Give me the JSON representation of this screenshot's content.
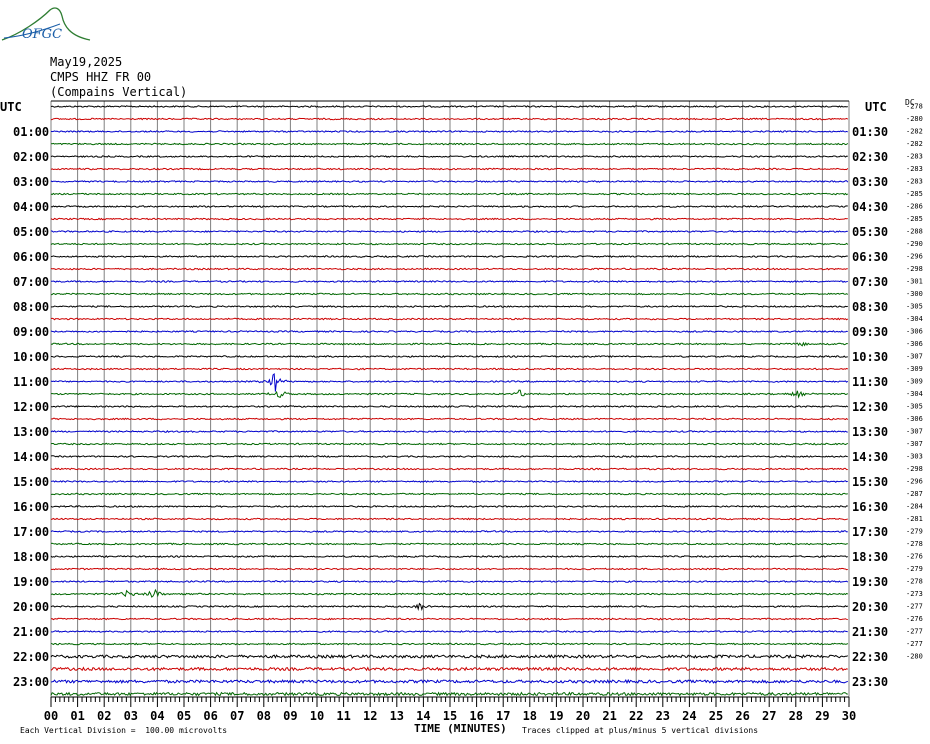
{
  "header": {
    "logo_text": "OFGC",
    "date": "May19,2025",
    "station": "CMPS HHZ FR 00",
    "station_name": "(Compains Vertical)",
    "left_utc": "UTC",
    "right_utc": "UTC",
    "dc_label": "DC"
  },
  "footer": {
    "left_note": "Each Vertical Division =  100.00 microvolts",
    "xlabel": "TIME (MINUTES)",
    "right_note": "Traces clipped at plus/minus 5 vertical divisions"
  },
  "colors": {
    "trace_cycle": [
      "#000000",
      "#cc0000",
      "#0000cc",
      "#006600"
    ],
    "grid": "#808080"
  },
  "chart_data": {
    "type": "line",
    "title": "",
    "xlabel": "TIME (MINUTES)",
    "ylabel": "",
    "xlim": [
      0,
      30
    ],
    "x_ticks": [
      "00",
      "01",
      "02",
      "03",
      "04",
      "05",
      "06",
      "07",
      "08",
      "09",
      "10",
      "11",
      "12",
      "13",
      "14",
      "15",
      "16",
      "17",
      "18",
      "19",
      "20",
      "21",
      "22",
      "23",
      "24",
      "25",
      "26",
      "27",
      "28",
      "29",
      "30"
    ],
    "left_hour_labels": [
      "01:00",
      "02:00",
      "03:00",
      "04:00",
      "05:00",
      "06:00",
      "07:00",
      "08:00",
      "09:00",
      "10:00",
      "11:00",
      "12:00",
      "13:00",
      "14:00",
      "15:00",
      "16:00",
      "17:00",
      "18:00",
      "19:00",
      "20:00",
      "21:00",
      "22:00",
      "23:00"
    ],
    "right_hour_labels": [
      "01:30",
      "02:30",
      "03:30",
      "04:30",
      "05:30",
      "06:30",
      "07:30",
      "08:30",
      "09:30",
      "10:30",
      "11:30",
      "12:30",
      "13:30",
      "14:30",
      "15:30",
      "16:30",
      "17:30",
      "18:30",
      "19:30",
      "20:30",
      "21:30",
      "22:30",
      "23:30"
    ],
    "trace_count": 48,
    "dc_offsets": [
      -278,
      -280,
      -282,
      -282,
      -283,
      -283,
      -283,
      -285,
      -286,
      -285,
      -288,
      -290,
      -296,
      -298,
      -301,
      -300,
      -305,
      -304,
      -306,
      -306,
      -307,
      -309,
      -309,
      -304,
      -305,
      -306,
      -307,
      -307,
      -303,
      -298,
      -296,
      -287,
      -284,
      -281,
      -279,
      -278,
      -276,
      -279,
      -278,
      -273,
      -277,
      -276,
      -277,
      -277,
      -280
    ],
    "grid": true,
    "events": [
      {
        "trace": 22,
        "minute": 8.4,
        "amplitude": 1.6,
        "label": "spike"
      },
      {
        "trace": 23,
        "minute": 8.6,
        "amplitude": 0.7,
        "label": "spike"
      },
      {
        "trace": 23,
        "minute": 17.6,
        "amplitude": 0.6,
        "label": "spike"
      },
      {
        "trace": 23,
        "minute": 28.1,
        "amplitude": 0.6,
        "label": "spike"
      },
      {
        "trace": 19,
        "minute": 28.2,
        "amplitude": 0.4,
        "label": "spike"
      },
      {
        "trace": 39,
        "minute": 2.9,
        "amplitude": 0.6,
        "label": "event"
      },
      {
        "trace": 39,
        "minute": 3.9,
        "amplitude": 1.0,
        "label": "event"
      },
      {
        "trace": 40,
        "minute": 13.9,
        "amplitude": 0.6,
        "label": "spike"
      }
    ]
  }
}
